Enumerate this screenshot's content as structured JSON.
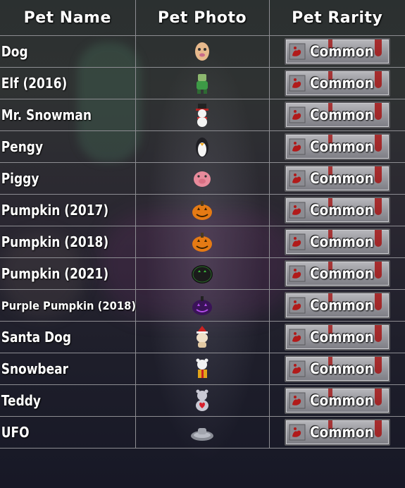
{
  "table": {
    "headers": {
      "name": "Pet Name",
      "photo": "Pet Photo",
      "rarity": "Pet Rarity"
    },
    "rows": [
      {
        "name": "Dog",
        "icon": "dog-pet-icon",
        "rarity": "Common"
      },
      {
        "name": "Elf (2016)",
        "icon": "elf-pet-icon",
        "rarity": "Common"
      },
      {
        "name": "Mr. Snowman",
        "icon": "snowman-pet-icon",
        "rarity": "Common"
      },
      {
        "name": "Pengy",
        "icon": "penguin-pet-icon",
        "rarity": "Common"
      },
      {
        "name": "Piggy",
        "icon": "pig-pet-icon",
        "rarity": "Common"
      },
      {
        "name": "Pumpkin (2017)",
        "icon": "pumpkin-pet-icon",
        "rarity": "Common"
      },
      {
        "name": "Pumpkin (2018)",
        "icon": "pumpkin-pet-icon",
        "rarity": "Common"
      },
      {
        "name": "Pumpkin (2021)",
        "icon": "dark-pumpkin-pet-icon",
        "rarity": "Common"
      },
      {
        "name": "Purple Pumpkin (2018)",
        "icon": "purple-pumpkin-pet-icon",
        "rarity": "Common"
      },
      {
        "name": "Santa Dog",
        "icon": "santa-dog-pet-icon",
        "rarity": "Common"
      },
      {
        "name": "Snowbear",
        "icon": "snowbear-pet-icon",
        "rarity": "Common"
      },
      {
        "name": "Teddy",
        "icon": "teddy-pet-icon",
        "rarity": "Common"
      },
      {
        "name": "UFO",
        "icon": "ufo-pet-icon",
        "rarity": "Common"
      }
    ]
  },
  "colors": {
    "grid_line": "#8d8d92",
    "badge_gray": "#9a9aa0",
    "blood_red": "#a31515",
    "text": "#ffffff"
  }
}
